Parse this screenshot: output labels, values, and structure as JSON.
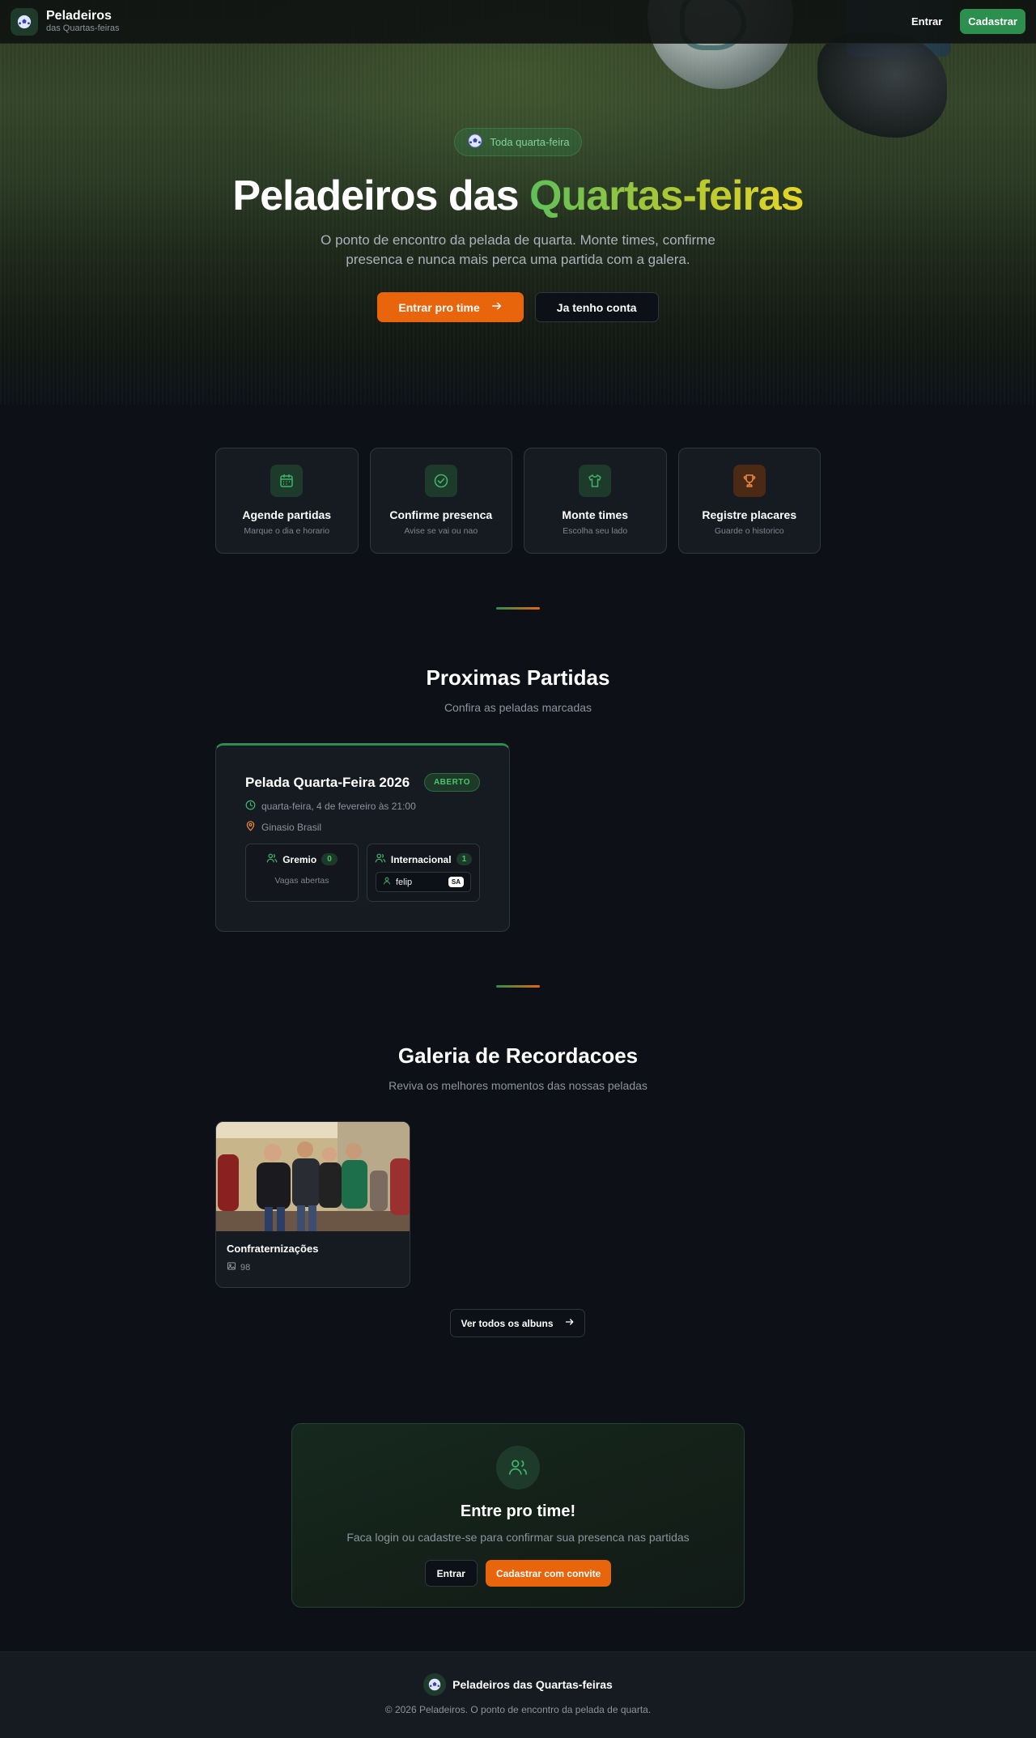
{
  "header": {
    "brand_title": "Peladeiros",
    "brand_subtitle": "das Quartas-feiras",
    "login_label": "Entrar",
    "signup_label": "Cadastrar"
  },
  "hero": {
    "pill_text": "Toda quarta-feira",
    "title_part1": "Peladeiros das ",
    "title_accent": "Quartas-feiras",
    "description": "O ponto de encontro da pelada de quarta. Monte times, confirme presenca e nunca mais perca uma partida com a galera.",
    "primary_button": "Entrar pro time",
    "secondary_button": "Ja tenho conta"
  },
  "features": [
    {
      "title": "Agende partidas",
      "subtitle": "Marque o dia e horario",
      "icon": "calendar-icon"
    },
    {
      "title": "Confirme presenca",
      "subtitle": "Avise se vai ou nao",
      "icon": "check-circle-icon"
    },
    {
      "title": "Monte times",
      "subtitle": "Escolha seu lado",
      "icon": "shirt-icon"
    },
    {
      "title": "Registre placares",
      "subtitle": "Guarde o historico",
      "icon": "trophy-icon"
    }
  ],
  "matches_section": {
    "title": "Proximas Partidas",
    "subtitle": "Confira as peladas marcadas",
    "match": {
      "title": "Pelada Quarta-Feira 2026",
      "status": "ABERTO",
      "datetime": "quarta-feira, 4 de fevereiro às 21:00",
      "location": "Ginasio Brasil",
      "teams": [
        {
          "name": "Gremio",
          "count": "0",
          "empty_text": "Vagas abertas"
        },
        {
          "name": "Internacional",
          "count": "1",
          "player": "felip",
          "player_tag": "SA"
        }
      ]
    }
  },
  "gallery_section": {
    "title": "Galeria de Recordacoes",
    "subtitle": "Reviva os melhores momentos das nossas peladas",
    "album": {
      "name": "Confraternizações",
      "count": "98"
    },
    "view_all_label": "Ver todos os albuns"
  },
  "cta": {
    "title": "Entre pro time!",
    "description": "Faca login ou cadastre-se para confirmar sua presenca nas partidas",
    "login_label": "Entrar",
    "signup_label": "Cadastrar com convite"
  },
  "footer": {
    "brand": "Peladeiros das Quartas-feiras",
    "copyright": "© 2026 Peladeiros. O ponto de encontro da pelada de quarta."
  },
  "colors": {
    "accent_green": "#2d8f4e",
    "accent_orange": "#e8650c",
    "background": "#0d1117",
    "card": "#161b22"
  }
}
